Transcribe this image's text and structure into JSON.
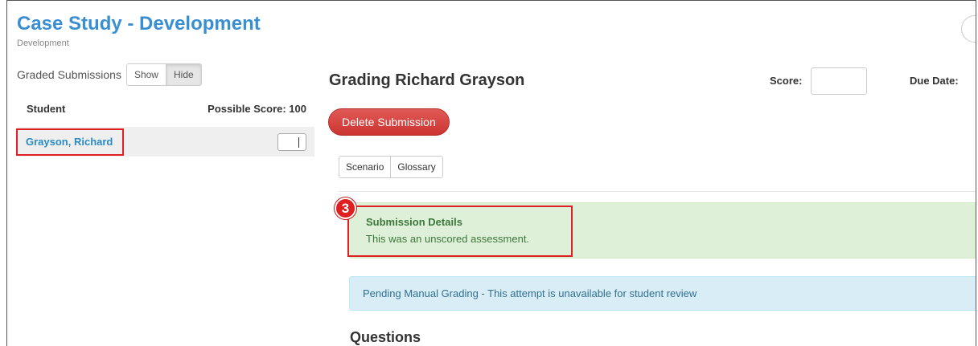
{
  "header": {
    "title": "Case Study - Development",
    "subtitle": "Development"
  },
  "left_panel": {
    "graded_label": "Graded Submissions",
    "toggle": {
      "show": "Show",
      "hide": "Hide",
      "active": "Hide"
    },
    "table": {
      "col_student": "Student",
      "col_score": "Possible Score: 100",
      "rows": [
        {
          "name": "Grayson, Richard",
          "score": ""
        }
      ]
    }
  },
  "main": {
    "grading_title": "Grading Richard Grayson",
    "score_label": "Score:",
    "score_value": "",
    "due_label": "Due Date:",
    "delete_label": "Delete Submission",
    "tabs": [
      {
        "label": "Scenario"
      },
      {
        "label": "Glossary"
      }
    ],
    "step_number": "3",
    "submission": {
      "title": "Submission Details",
      "text": "This was an unscored assessment."
    },
    "info_text": "Pending Manual Grading - This attempt is unavailable for student review",
    "questions_title": "Questions"
  },
  "colors": {
    "title_blue": "#3a8fd3",
    "link_blue": "#2a8bc5",
    "delete_red": "#d9534f",
    "highlight_red": "#e02020",
    "success_bg": "#dff0d8",
    "success_text": "#3c763d",
    "info_bg": "#d9edf7",
    "info_text": "#31708f"
  }
}
